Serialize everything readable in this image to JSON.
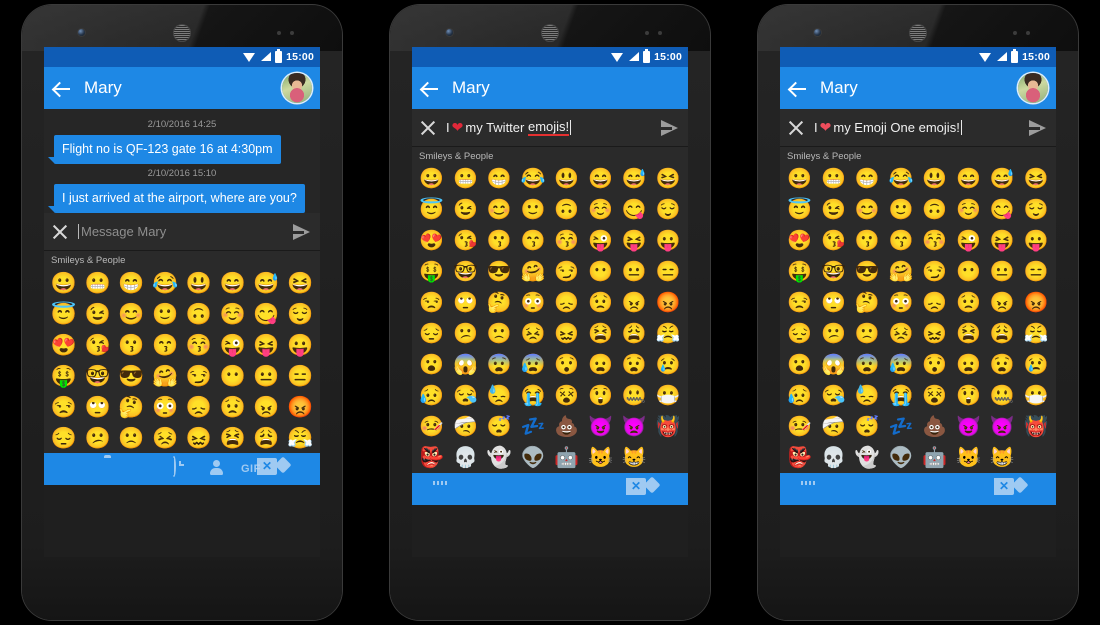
{
  "app": {
    "status_bar": {
      "time": "15:00",
      "wifi_icon": "wifi-icon",
      "signal_icon": "signal-icon",
      "battery_icon": "battery-icon"
    },
    "colors": {
      "status_bar": "#0f5cb5",
      "app_bar": "#1e88e5",
      "bubble": "#1e88e5",
      "keyboard_bg": "#2a2a2a",
      "conversation_bg": "#262626",
      "compose_bg": "#2b2b2b",
      "heart": "#e02839",
      "spellcheck_underline": "#e53030"
    }
  },
  "phones": [
    {
      "id": "phone-1",
      "header": {
        "back_icon": "back-arrow-icon",
        "title": "Mary",
        "avatar": "contact-avatar"
      },
      "conversation": {
        "messages": [
          {
            "timestamp": "2/10/2016 14:25",
            "text": "Flight no is QF-123  gate 16 at 4:30pm"
          },
          {
            "timestamp": "2/10/2016 15:10",
            "text": "I just arrived at the airport, where are you?"
          }
        ]
      },
      "compose": {
        "close_icon": "close-icon",
        "placeholder": "Message Mary",
        "value": "",
        "send_icon": "send-icon"
      },
      "keyboard": {
        "category": "Smileys & People",
        "style": "android",
        "emoji": [
          "😀",
          "😬",
          "😁",
          "😂",
          "😃",
          "😄",
          "😅",
          "😆",
          "😇",
          "😉",
          "😊",
          "🙂",
          "🙃",
          "☺️",
          "😋",
          "😌",
          "😍",
          "😘",
          "😗",
          "😙",
          "😚",
          "😜",
          "😝",
          "😛",
          "🤑",
          "🤓",
          "😎",
          "🤗",
          "😏",
          "😶",
          "😐",
          "😑",
          "😒",
          "🙄",
          "🤔",
          "😳",
          "😞",
          "😟",
          "😠",
          "😡",
          "😔",
          "😕",
          "🙁",
          "😣",
          "😖",
          "😫",
          "😩",
          "😤"
        ],
        "toolbar": [
          {
            "name": "emoji-tab",
            "icon": "smiley-icon",
            "label": "",
            "active": true
          },
          {
            "name": "camera-tab",
            "icon": "camera-icon",
            "label": "",
            "active": false
          },
          {
            "name": "gallery-tab",
            "icon": "image-icon",
            "label": "",
            "active": false
          },
          {
            "name": "recent-tab",
            "icon": "history-icon",
            "label": "",
            "active": false
          },
          {
            "name": "contact-tab",
            "icon": "person-icon",
            "label": "",
            "active": false
          },
          {
            "name": "gif-tab",
            "icon": "gif-icon",
            "label": "GIF",
            "active": false
          },
          {
            "name": "backspace-key",
            "icon": "backspace-icon",
            "label": "",
            "active": false
          }
        ]
      }
    },
    {
      "id": "phone-2",
      "header": {
        "back_icon": "back-arrow-icon",
        "title": "Mary",
        "avatar": null
      },
      "compose": {
        "close_icon": "close-icon",
        "prefix": "I",
        "heart": "❤",
        "text_before": "my Twitter",
        "misspelled": "emojis!",
        "send_icon": "send-icon",
        "full_value": "I ❤ my Twitter emojis!"
      },
      "keyboard": {
        "category": "Smileys & People",
        "style": "twitter",
        "emoji": [
          "😀",
          "😬",
          "😁",
          "😂",
          "😃",
          "😄",
          "😅",
          "😆",
          "😇",
          "😉",
          "😊",
          "🙂",
          "🙃",
          "☺️",
          "😋",
          "😌",
          "😍",
          "😘",
          "😗",
          "😙",
          "😚",
          "😜",
          "😝",
          "😛",
          "🤑",
          "🤓",
          "😎",
          "🤗",
          "😏",
          "😶",
          "😐",
          "😑",
          "😒",
          "🙄",
          "🤔",
          "😳",
          "😞",
          "😟",
          "😠",
          "😡",
          "😔",
          "😕",
          "🙁",
          "😣",
          "😖",
          "😫",
          "😩",
          "😤",
          "😮",
          "😱",
          "😨",
          "😰",
          "😯",
          "😦",
          "😧",
          "😢",
          "😥",
          "😪",
          "😓",
          "😭",
          "😵",
          "😲",
          "🤐",
          "😷",
          "🤒",
          "🤕",
          "😴",
          "💤",
          "💩",
          "😈",
          "👿",
          "👹",
          "👺",
          "💀",
          "👻",
          "👽",
          "🤖",
          "😺",
          "😸"
        ],
        "toolbar": [
          {
            "name": "keyboard-switch-key",
            "icon": "keyboard-icon",
            "label": "",
            "active": false
          },
          {
            "name": "backspace-key",
            "icon": "backspace-icon",
            "label": "",
            "active": false
          }
        ]
      }
    },
    {
      "id": "phone-3",
      "header": {
        "back_icon": "back-arrow-icon",
        "title": "Mary",
        "avatar": "contact-avatar"
      },
      "compose": {
        "close_icon": "close-icon",
        "prefix": "I",
        "heart": "❤",
        "text_before": "my Emoji One",
        "misspelled": "",
        "trailing": "emojis!",
        "send_icon": "send-icon",
        "full_value": "I ❤ my Emoji One emojis!"
      },
      "keyboard": {
        "category": "Smileys & People",
        "style": "emojione",
        "emoji": [
          "😀",
          "😬",
          "😁",
          "😂",
          "😃",
          "😄",
          "😅",
          "😆",
          "😇",
          "😉",
          "😊",
          "🙂",
          "🙃",
          "☺️",
          "😋",
          "😌",
          "😍",
          "😘",
          "😗",
          "😙",
          "😚",
          "😜",
          "😝",
          "😛",
          "🤑",
          "🤓",
          "😎",
          "🤗",
          "😏",
          "😶",
          "😐",
          "😑",
          "😒",
          "🙄",
          "🤔",
          "😳",
          "😞",
          "😟",
          "😠",
          "😡",
          "😔",
          "😕",
          "🙁",
          "😣",
          "😖",
          "😫",
          "😩",
          "😤",
          "😮",
          "😱",
          "😨",
          "😰",
          "😯",
          "😦",
          "😧",
          "😢",
          "😥",
          "😪",
          "😓",
          "😭",
          "😵",
          "😲",
          "🤐",
          "😷",
          "🤒",
          "🤕",
          "😴",
          "💤",
          "💩",
          "😈",
          "👿",
          "👹",
          "👺",
          "💀",
          "👻",
          "👽",
          "🤖",
          "😺",
          "😸"
        ],
        "toolbar": [
          {
            "name": "keyboard-switch-key",
            "icon": "keyboard-icon",
            "label": "",
            "active": false
          },
          {
            "name": "backspace-key",
            "icon": "backspace-icon",
            "label": "",
            "active": false
          }
        ]
      }
    }
  ]
}
